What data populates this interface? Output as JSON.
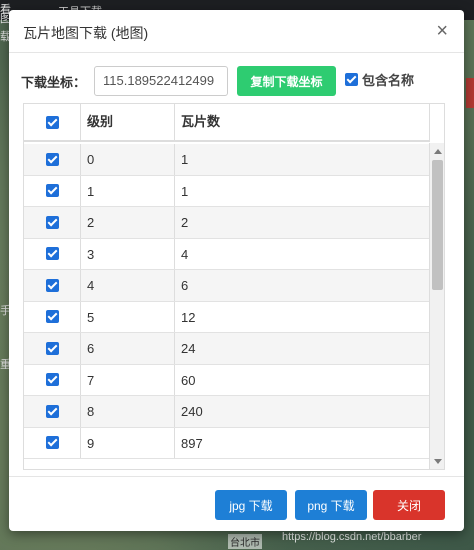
{
  "background": {
    "topbar_text": "工具下载",
    "left_fragments": [
      "看",
      "图",
      "载",
      "手",
      "重"
    ],
    "city_label": "台北市",
    "watermark": "https://blog.csdn.net/bbarber"
  },
  "dialog": {
    "title": "瓦片地图下载 (地图)",
    "close_label": "×",
    "coord_label": "下载坐标：",
    "coord_value": "115.189522412499",
    "copy_button": "复制下载坐标",
    "include_name": {
      "label": "包含名称",
      "checked": true
    },
    "table": {
      "headers": {
        "level": "级别",
        "tiles": "瓦片数"
      },
      "rows": [
        {
          "level": "0",
          "tiles": "1",
          "checked": true
        },
        {
          "level": "1",
          "tiles": "1",
          "checked": true
        },
        {
          "level": "2",
          "tiles": "2",
          "checked": true
        },
        {
          "level": "3",
          "tiles": "4",
          "checked": true
        },
        {
          "level": "4",
          "tiles": "6",
          "checked": true
        },
        {
          "level": "5",
          "tiles": "12",
          "checked": true
        },
        {
          "level": "6",
          "tiles": "24",
          "checked": true
        },
        {
          "level": "7",
          "tiles": "60",
          "checked": true
        },
        {
          "level": "8",
          "tiles": "240",
          "checked": true
        },
        {
          "level": "9",
          "tiles": "897",
          "checked": true
        }
      ]
    },
    "footer": {
      "jpg_button": "jpg 下载",
      "png_button": "png 下载",
      "close_button": "关闭"
    }
  },
  "colors": {
    "primary": "#1e7fd6",
    "success": "#2ecc71",
    "danger": "#d9342b",
    "checkbox": "#1e6fd9"
  }
}
